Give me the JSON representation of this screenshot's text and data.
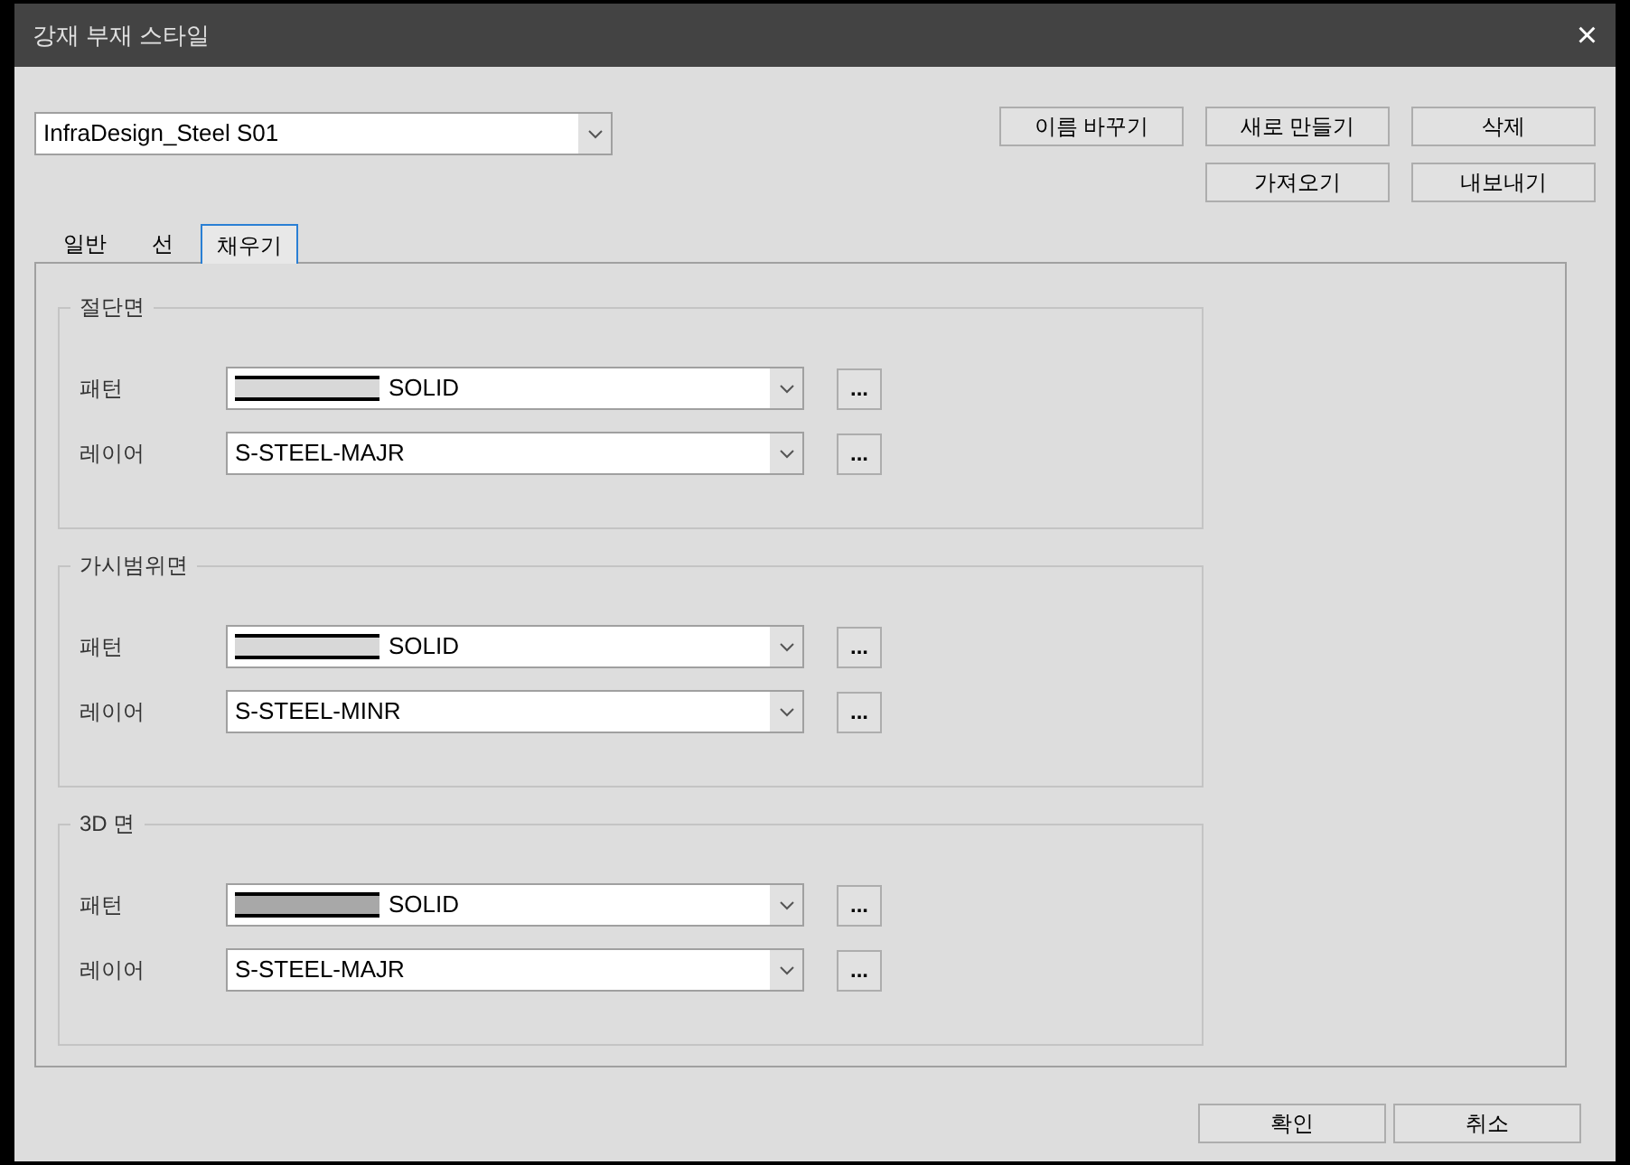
{
  "window": {
    "title": "강재 부재 스타일",
    "close": "×"
  },
  "style_select": {
    "value": "InfraDesign_Steel S01"
  },
  "actions": [
    {
      "label": "이름 바꾸기"
    },
    {
      "label": "새로 만들기"
    },
    {
      "label": "삭제"
    },
    {
      "label": "가져오기"
    },
    {
      "label": "내보내기"
    }
  ],
  "tabs": [
    {
      "label": "일반",
      "selected": false
    },
    {
      "label": "선",
      "selected": false
    },
    {
      "label": "채우기",
      "selected": true
    }
  ],
  "groups": [
    {
      "title": "절단면",
      "rows": [
        {
          "kind": "pattern",
          "label": "패턴",
          "value": "SOLID",
          "color": "#d8d8d8",
          "more": "..."
        },
        {
          "kind": "layer",
          "label": "레이어",
          "value": "S-STEEL-MAJR",
          "more": "..."
        }
      ]
    },
    {
      "title": "가시범위면",
      "rows": [
        {
          "kind": "pattern",
          "label": "패턴",
          "value": "SOLID",
          "color": "#d8d8d8",
          "more": "..."
        },
        {
          "kind": "layer",
          "label": "레이어",
          "value": "S-STEEL-MINR",
          "more": "..."
        }
      ]
    },
    {
      "title": "3D 면",
      "rows": [
        {
          "kind": "pattern",
          "label": "패턴",
          "value": "SOLID",
          "color": "#a8a8a8",
          "more": "..."
        },
        {
          "kind": "layer",
          "label": "레이어",
          "value": "S-STEEL-MAJR",
          "more": "..."
        }
      ]
    }
  ],
  "footer": [
    {
      "label": "확인"
    },
    {
      "label": "취소"
    }
  ]
}
